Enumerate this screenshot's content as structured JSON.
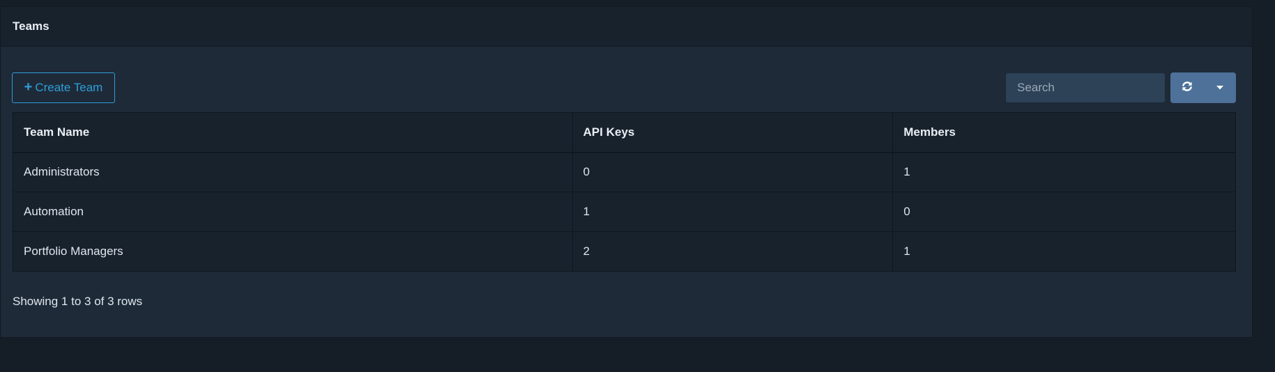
{
  "panel": {
    "title": "Teams"
  },
  "toolbar": {
    "create_label": "Create Team",
    "create_icon": "plus-icon",
    "search_placeholder": "Search",
    "search_value": "",
    "refresh_icon": "refresh-icon",
    "dropdown_icon": "caret-down-icon"
  },
  "table": {
    "headers": {
      "name": "Team Name",
      "api_keys": "API Keys",
      "members": "Members"
    },
    "rows": [
      {
        "name": "Administrators",
        "api_keys": "0",
        "members": "1"
      },
      {
        "name": "Automation",
        "api_keys": "1",
        "members": "0"
      },
      {
        "name": "Portfolio Managers",
        "api_keys": "2",
        "members": "1"
      }
    ]
  },
  "footer": {
    "pagination_text": "Showing 1 to 3 of 3 rows"
  },
  "colors": {
    "page_background": "#151e27",
    "panel_background": "#1e2a38",
    "header_background": "#18222d",
    "accent": "#2f9ed7",
    "button_background": "#4d7199",
    "search_background": "#2d4257"
  }
}
